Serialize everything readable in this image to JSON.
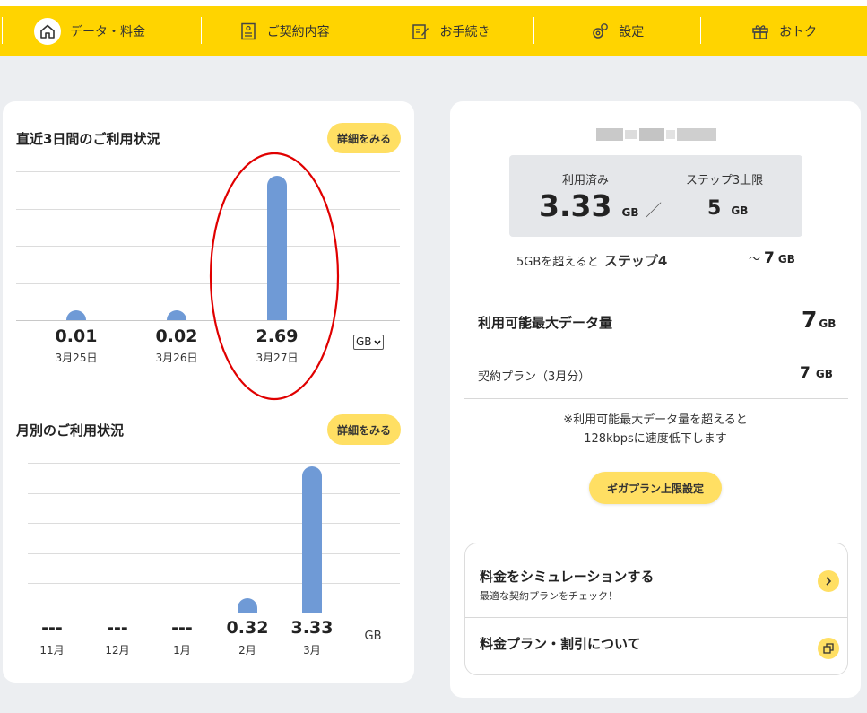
{
  "nav": {
    "items": [
      {
        "label": "データ・料金",
        "icon": "home-icon"
      },
      {
        "label": "ご契約内容",
        "icon": "contract-icon"
      },
      {
        "label": "お手続き",
        "icon": "edit-icon"
      },
      {
        "label": "設定",
        "icon": "settings-icon"
      },
      {
        "label": "おトク",
        "icon": "gift-icon"
      }
    ],
    "active_index": 0
  },
  "recent": {
    "title": "直近3日間のご利用状況",
    "detail_button": "詳細をみる",
    "unit_select": "GB",
    "days": [
      {
        "value": "0.01",
        "date": "3月25日"
      },
      {
        "value": "0.02",
        "date": "3月26日"
      },
      {
        "value": "2.69",
        "date": "3月27日"
      }
    ]
  },
  "monthly": {
    "title": "月別のご利用状況",
    "detail_button": "詳細をみる",
    "unit": "GB",
    "months": [
      {
        "value": "---",
        "month": "11月"
      },
      {
        "value": "---",
        "month": "12月"
      },
      {
        "value": "---",
        "month": "1月"
      },
      {
        "value": "0.32",
        "month": "2月"
      },
      {
        "value": "3.33",
        "month": "3月"
      }
    ]
  },
  "chart_data": [
    {
      "type": "bar",
      "title": "直近3日間のご利用状況",
      "categories": [
        "3月25日",
        "3月26日",
        "3月27日"
      ],
      "values": [
        0.01,
        0.02,
        2.69
      ],
      "ylabel": "GB"
    },
    {
      "type": "bar",
      "title": "月別のご利用状況",
      "categories": [
        "11月",
        "12月",
        "1月",
        "2月",
        "3月"
      ],
      "values": [
        null,
        null,
        null,
        0.32,
        3.33
      ],
      "ylabel": "GB"
    }
  ],
  "usage": {
    "used_label": "利用済み",
    "used_value": "3.33",
    "used_unit": "GB",
    "separator": "／",
    "limit_label": "ステップ3上限",
    "limit_value": "5",
    "limit_unit": "GB",
    "next_prefix": "5GBを超えると",
    "next_step": "ステップ4",
    "next_tilde": "～",
    "next_value": "7",
    "next_unit": "GB"
  },
  "max_data": {
    "label": "利用可能最大データ量",
    "value": "7",
    "unit": "GB"
  },
  "plan": {
    "label": "契約プラン（3月分）",
    "value": "7",
    "unit": "GB"
  },
  "notice": {
    "line1": "※利用可能最大データ量を超えると",
    "line2": "128kbpsに速度低下します"
  },
  "giga_button": "ギガプラン上限設定",
  "links": {
    "simulate_title": "料金をシミュレーションする",
    "simulate_sub": "最適な契約プランをチェック！",
    "plans_title": "料金プラン・割引について"
  },
  "colors": {
    "nav_bg": "#ffd400",
    "bar": "#6f9ad6",
    "button": "#ffdf63",
    "annotation": "#e00000"
  }
}
